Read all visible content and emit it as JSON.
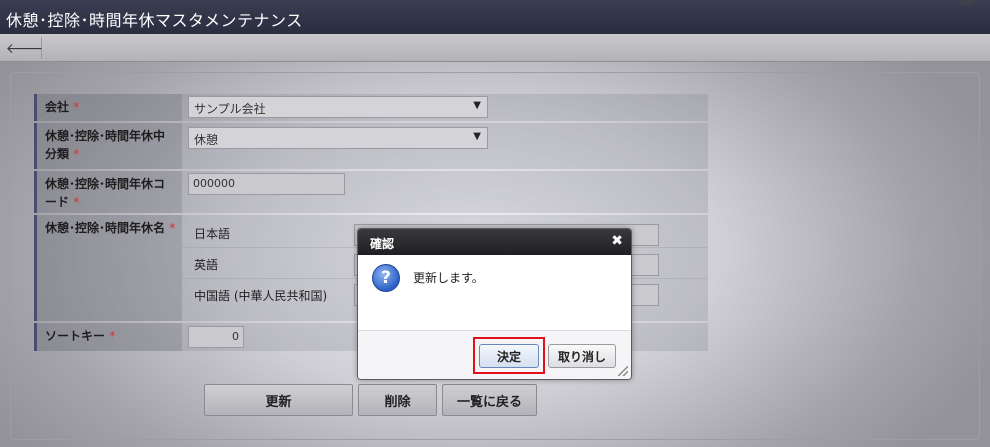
{
  "header": {
    "title": "休憩･控除･時間年休マスタメンテナンス"
  },
  "toolbar": {
    "back_icon": "arrow-left-icon",
    "back_glyph": "🡐"
  },
  "form": {
    "company": {
      "label": "会社",
      "required_mark": "*",
      "value": "サンプル会社"
    },
    "category": {
      "label": "休憩･控除･時間年休中分類",
      "required_mark": "*",
      "value": "休憩"
    },
    "code": {
      "label": "休憩･控除･時間年休コード",
      "required_mark": "*",
      "value": "000000"
    },
    "name": {
      "label": "休憩･控除･時間年休名",
      "required_mark": "*",
      "languages": [
        "日本語",
        "英語",
        "中国語 (中華人民共和国)"
      ]
    },
    "sort_key": {
      "label": "ソートキー",
      "required_mark": "*",
      "value": "0"
    }
  },
  "actions": {
    "update": "更新",
    "delete": "削除",
    "back_to_list": "一覧に戻る"
  },
  "dialog": {
    "title": "確認",
    "close_glyph": "✖",
    "icon_glyph": "?",
    "message": "更新します。",
    "confirm": "決定",
    "cancel": "取り消し"
  },
  "colors": {
    "required": "#c0393b",
    "highlight": "#e0101c",
    "titlebar": "#2f3145"
  }
}
